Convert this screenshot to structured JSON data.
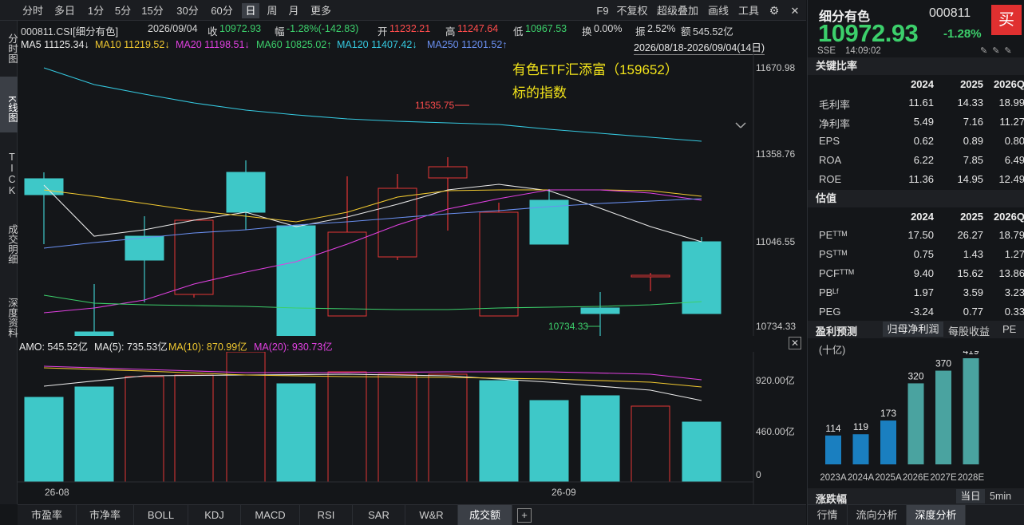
{
  "toolbar": {
    "periods": [
      "分时",
      "多日",
      "1分",
      "5分",
      "15分",
      "30分",
      "60分",
      "日",
      "周",
      "月",
      "更多"
    ],
    "active_period": "日",
    "right_tools": [
      "F9",
      "不复权",
      "超级叠加",
      "画线",
      "工具"
    ]
  },
  "left_tabs": [
    "分时图",
    "K线图",
    "TICK",
    "成交明细",
    "深度资料"
  ],
  "info_bar": {
    "code": "000811.CSI[细分有色]",
    "date": "2026/09/04",
    "close_label": "收",
    "close": "10972.93",
    "change_label": "幅",
    "change": "-1.28%(-142.83)",
    "open_label": "开",
    "open": "11232.21",
    "high_label": "高",
    "high": "11247.64",
    "low_label": "低",
    "low": "10967.53",
    "turnover_label": "换",
    "turnover": "0.00%",
    "amplitude_label": "振",
    "amplitude": "2.52%",
    "amount_label": "额",
    "amount": "545.52亿"
  },
  "ma_bar": {
    "ma5": "MA5  11125.34↓",
    "ma10": "MA10  11219.52↓",
    "ma20": "MA20  11198.51↓",
    "ma60": "MA60  10825.02↑",
    "ma120": "MA120  11407.42↓",
    "ma250": "MA250  11201.52↑",
    "range": "2026/08/18-2026/09/04(14日)"
  },
  "annotation": {
    "line1": "有色ETF汇添富（159652）",
    "line2": "标的指数"
  },
  "price_axis": [
    "11670.98",
    "11358.76",
    "11046.55",
    "10734.33"
  ],
  "high_marker": "11535.75",
  "low_marker": "10734.33",
  "vol_bar": {
    "amo": "AMO: 545.52亿",
    "ma5": "MA(5): 735.53亿",
    "ma10": "MA(10): 870.99亿",
    "ma20": "MA(20): 930.73亿"
  },
  "vol_axis": [
    "920.00亿",
    "460.00亿",
    "0"
  ],
  "date_axis": [
    "26-08",
    "26-09"
  ],
  "bottom_tabs": [
    "市盈率",
    "市净率",
    "BOLL",
    "KDJ",
    "MACD",
    "RSI",
    "SAR",
    "W&R",
    "成交额",
    "+"
  ],
  "stock": {
    "name": "细分有色",
    "code": "000811",
    "price": "10972.93",
    "change_pct": "-1.28%",
    "exchange": "SSE",
    "time": "14:09:02",
    "buy_label": "买"
  },
  "key_ratios": {
    "title": "关键比率",
    "years": [
      "2024",
      "2025",
      "2026Q"
    ],
    "rows": [
      {
        "label": "毛利率",
        "values": [
          "11.61",
          "14.33",
          "18.99"
        ]
      },
      {
        "label": "净利率",
        "values": [
          "5.49",
          "7.16",
          "11.27"
        ]
      },
      {
        "label": "EPS",
        "values": [
          "0.62",
          "0.89",
          "0.80"
        ]
      },
      {
        "label": "ROA",
        "values": [
          "6.22",
          "7.85",
          "6.49"
        ]
      },
      {
        "label": "ROE",
        "values": [
          "11.36",
          "14.95",
          "12.49"
        ]
      }
    ]
  },
  "valuation": {
    "title": "估值",
    "years": [
      "2024",
      "2025",
      "2026Q"
    ],
    "rows": [
      {
        "label": "PEᵀᵀᴹ",
        "values": [
          "17.50",
          "26.27",
          "18.79"
        ]
      },
      {
        "label": "PSᵀᵀᴹ",
        "values": [
          "0.75",
          "1.43",
          "1.27"
        ]
      },
      {
        "label": "PCFᵀᵀᴹ",
        "values": [
          "9.40",
          "15.62",
          "13.86"
        ]
      },
      {
        "label": "PBᴸᶠ",
        "values": [
          "1.97",
          "3.59",
          "3.23"
        ]
      },
      {
        "label": "PEG",
        "values": [
          "-3.24",
          "0.77",
          "0.33"
        ]
      }
    ]
  },
  "profit_forecast": {
    "title": "盈利预测",
    "tabs": [
      "归母净利润",
      "每股收益",
      "PE"
    ],
    "unit": "(十亿)",
    "bars": [
      {
        "year": "2023A",
        "value": 114,
        "label": "114",
        "color": "#1a7fc0"
      },
      {
        "year": "2024A",
        "value": 119,
        "label": "119",
        "color": "#1a7fc0"
      },
      {
        "year": "2025A",
        "value": 173,
        "label": "173",
        "color": "#1a7fc0"
      },
      {
        "year": "2026E",
        "value": 320,
        "label": "320",
        "color": "#4aa3a0"
      },
      {
        "year": "2027E",
        "value": 370,
        "label": "370",
        "color": "#4aa3a0"
      },
      {
        "year": "2028E",
        "value": 419,
        "label": "419",
        "color": "#4aa3a0"
      }
    ]
  },
  "range_section": {
    "title": "涨跌幅",
    "tabs": [
      "当日",
      "5min"
    ]
  },
  "right_bottom_tabs": [
    "行情",
    "流向分析",
    "深度分析"
  ]
}
